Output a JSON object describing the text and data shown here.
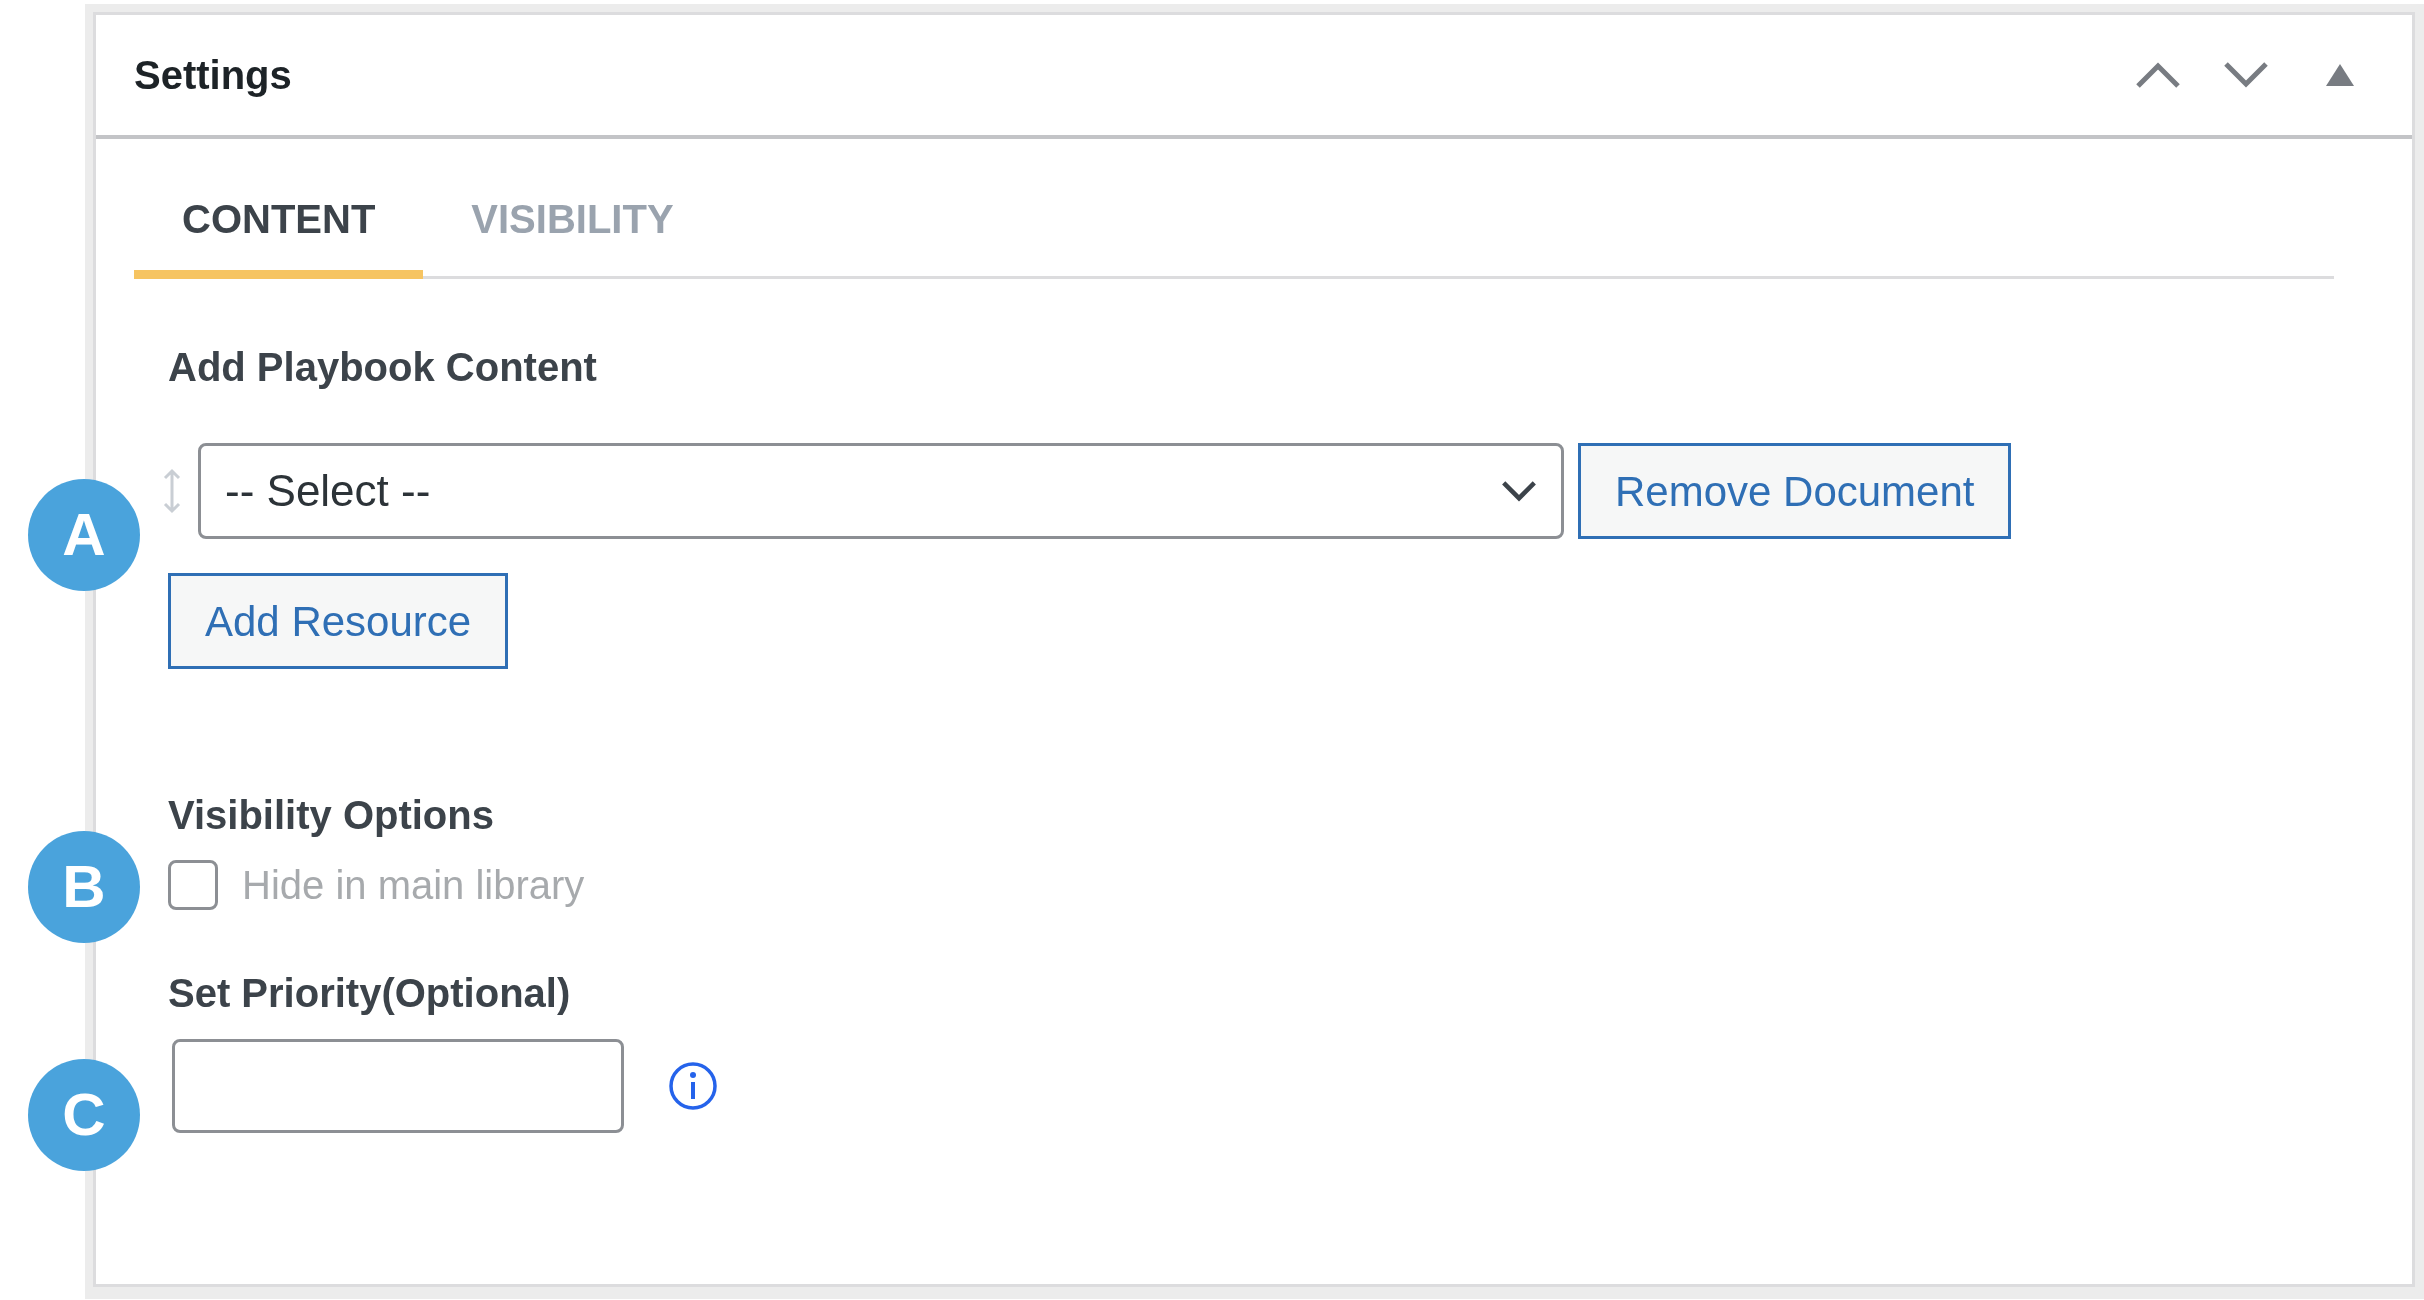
{
  "panel": {
    "title": "Settings"
  },
  "tabs": [
    {
      "label": "CONTENT",
      "selected": true
    },
    {
      "label": "VISIBILITY",
      "selected": false
    }
  ],
  "content": {
    "heading": "Add Playbook Content",
    "select": {
      "value": "-- Select --"
    },
    "remove_button": "Remove Document",
    "add_button": "Add Resource"
  },
  "visibility": {
    "heading": "Visibility Options",
    "checkbox": {
      "label": "Hide in main library",
      "checked": false
    }
  },
  "priority": {
    "label": "Set Priority(Optional)"
  },
  "callouts": [
    "A",
    "B",
    "C"
  ]
}
